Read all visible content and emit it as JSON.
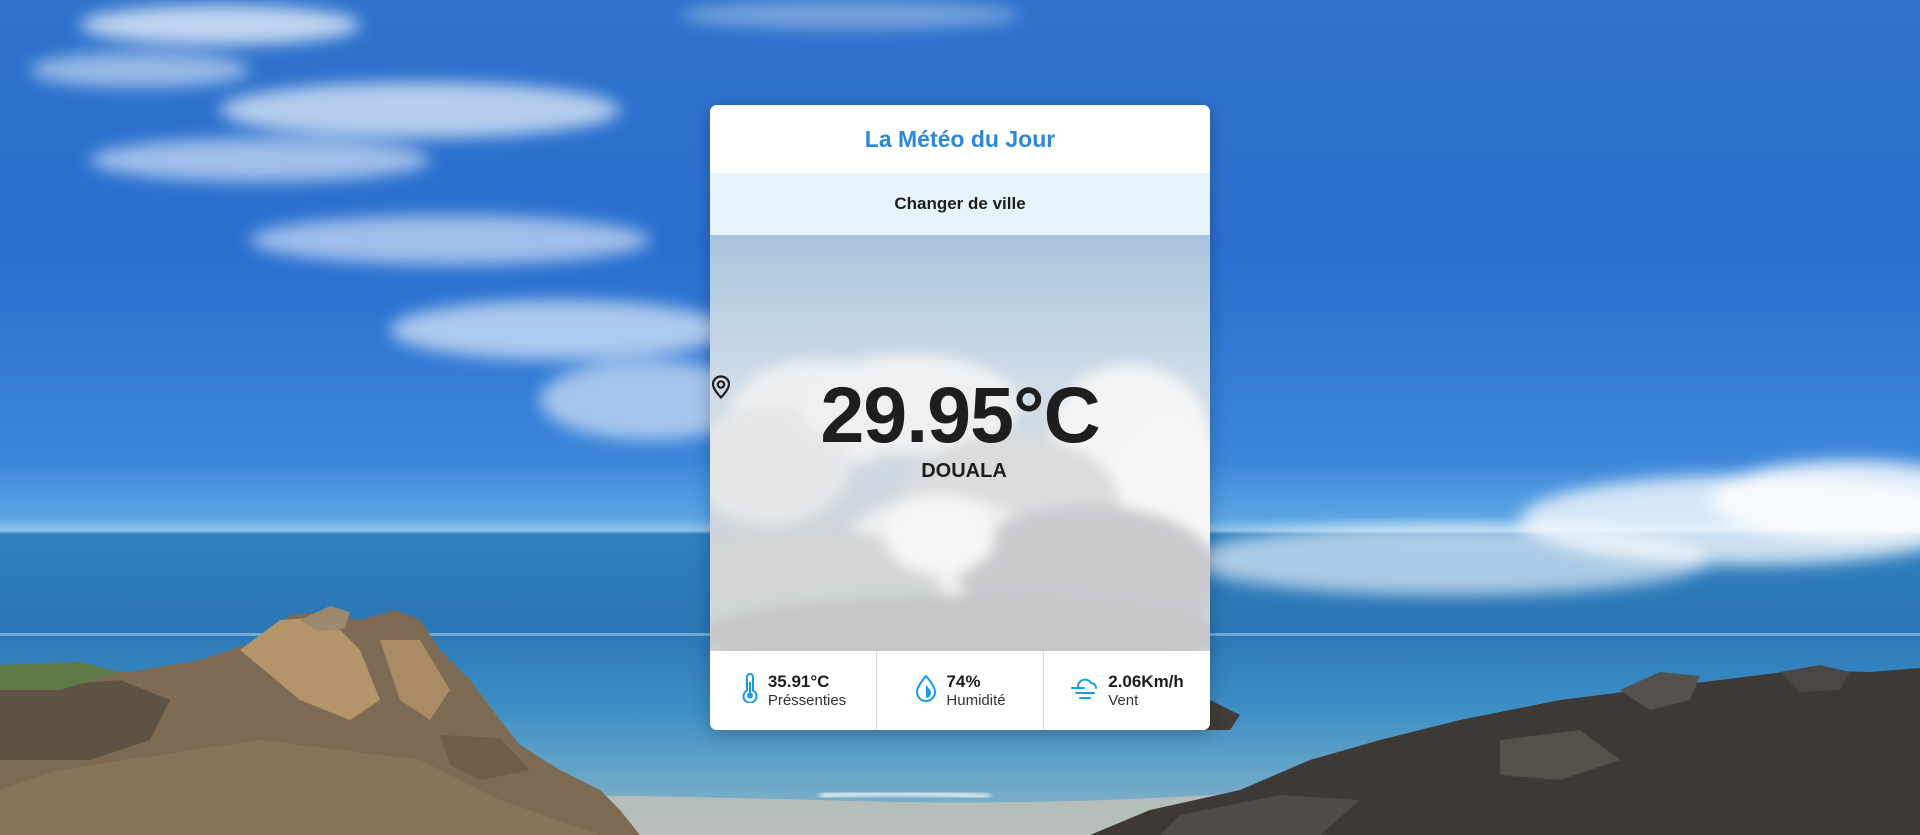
{
  "app": {
    "title": "La Météo du Jour",
    "change_city_label": "Changer de ville"
  },
  "weather": {
    "temperature": "29.95°C",
    "city": "DOUALA",
    "location_icon": "map-pin-icon"
  },
  "stats": {
    "feels_like": {
      "value": "35.91°C",
      "label": "Préssenties",
      "icon": "thermometer-icon"
    },
    "humidity": {
      "value": "74%",
      "label": "Humidité",
      "icon": "water-drop-icon"
    },
    "wind": {
      "value": "2.06Km/h",
      "label": "Vent",
      "icon": "wind-cloud-icon"
    }
  },
  "colors": {
    "accent": "#2e86d6",
    "button_bg": "#e7f3fb",
    "icon_blue": "#1a9be6"
  }
}
